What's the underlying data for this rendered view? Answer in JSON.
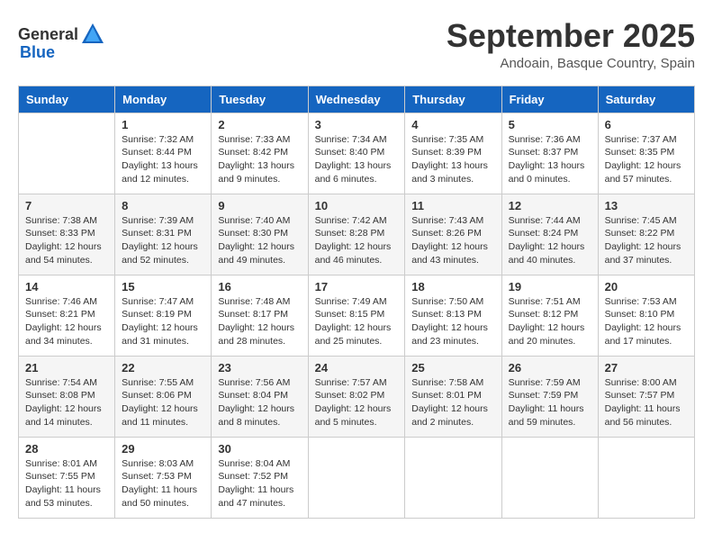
{
  "logo": {
    "general": "General",
    "blue": "Blue"
  },
  "title": "September 2025",
  "subtitle": "Andoain, Basque Country, Spain",
  "headers": [
    "Sunday",
    "Monday",
    "Tuesday",
    "Wednesday",
    "Thursday",
    "Friday",
    "Saturday"
  ],
  "weeks": [
    [
      {
        "day": "",
        "info": ""
      },
      {
        "day": "1",
        "info": "Sunrise: 7:32 AM\nSunset: 8:44 PM\nDaylight: 13 hours\nand 12 minutes."
      },
      {
        "day": "2",
        "info": "Sunrise: 7:33 AM\nSunset: 8:42 PM\nDaylight: 13 hours\nand 9 minutes."
      },
      {
        "day": "3",
        "info": "Sunrise: 7:34 AM\nSunset: 8:40 PM\nDaylight: 13 hours\nand 6 minutes."
      },
      {
        "day": "4",
        "info": "Sunrise: 7:35 AM\nSunset: 8:39 PM\nDaylight: 13 hours\nand 3 minutes."
      },
      {
        "day": "5",
        "info": "Sunrise: 7:36 AM\nSunset: 8:37 PM\nDaylight: 13 hours\nand 0 minutes."
      },
      {
        "day": "6",
        "info": "Sunrise: 7:37 AM\nSunset: 8:35 PM\nDaylight: 12 hours\nand 57 minutes."
      }
    ],
    [
      {
        "day": "7",
        "info": "Sunrise: 7:38 AM\nSunset: 8:33 PM\nDaylight: 12 hours\nand 54 minutes."
      },
      {
        "day": "8",
        "info": "Sunrise: 7:39 AM\nSunset: 8:31 PM\nDaylight: 12 hours\nand 52 minutes."
      },
      {
        "day": "9",
        "info": "Sunrise: 7:40 AM\nSunset: 8:30 PM\nDaylight: 12 hours\nand 49 minutes."
      },
      {
        "day": "10",
        "info": "Sunrise: 7:42 AM\nSunset: 8:28 PM\nDaylight: 12 hours\nand 46 minutes."
      },
      {
        "day": "11",
        "info": "Sunrise: 7:43 AM\nSunset: 8:26 PM\nDaylight: 12 hours\nand 43 minutes."
      },
      {
        "day": "12",
        "info": "Sunrise: 7:44 AM\nSunset: 8:24 PM\nDaylight: 12 hours\nand 40 minutes."
      },
      {
        "day": "13",
        "info": "Sunrise: 7:45 AM\nSunset: 8:22 PM\nDaylight: 12 hours\nand 37 minutes."
      }
    ],
    [
      {
        "day": "14",
        "info": "Sunrise: 7:46 AM\nSunset: 8:21 PM\nDaylight: 12 hours\nand 34 minutes."
      },
      {
        "day": "15",
        "info": "Sunrise: 7:47 AM\nSunset: 8:19 PM\nDaylight: 12 hours\nand 31 minutes."
      },
      {
        "day": "16",
        "info": "Sunrise: 7:48 AM\nSunset: 8:17 PM\nDaylight: 12 hours\nand 28 minutes."
      },
      {
        "day": "17",
        "info": "Sunrise: 7:49 AM\nSunset: 8:15 PM\nDaylight: 12 hours\nand 25 minutes."
      },
      {
        "day": "18",
        "info": "Sunrise: 7:50 AM\nSunset: 8:13 PM\nDaylight: 12 hours\nand 23 minutes."
      },
      {
        "day": "19",
        "info": "Sunrise: 7:51 AM\nSunset: 8:12 PM\nDaylight: 12 hours\nand 20 minutes."
      },
      {
        "day": "20",
        "info": "Sunrise: 7:53 AM\nSunset: 8:10 PM\nDaylight: 12 hours\nand 17 minutes."
      }
    ],
    [
      {
        "day": "21",
        "info": "Sunrise: 7:54 AM\nSunset: 8:08 PM\nDaylight: 12 hours\nand 14 minutes."
      },
      {
        "day": "22",
        "info": "Sunrise: 7:55 AM\nSunset: 8:06 PM\nDaylight: 12 hours\nand 11 minutes."
      },
      {
        "day": "23",
        "info": "Sunrise: 7:56 AM\nSunset: 8:04 PM\nDaylight: 12 hours\nand 8 minutes."
      },
      {
        "day": "24",
        "info": "Sunrise: 7:57 AM\nSunset: 8:02 PM\nDaylight: 12 hours\nand 5 minutes."
      },
      {
        "day": "25",
        "info": "Sunrise: 7:58 AM\nSunset: 8:01 PM\nDaylight: 12 hours\nand 2 minutes."
      },
      {
        "day": "26",
        "info": "Sunrise: 7:59 AM\nSunset: 7:59 PM\nDaylight: 11 hours\nand 59 minutes."
      },
      {
        "day": "27",
        "info": "Sunrise: 8:00 AM\nSunset: 7:57 PM\nDaylight: 11 hours\nand 56 minutes."
      }
    ],
    [
      {
        "day": "28",
        "info": "Sunrise: 8:01 AM\nSunset: 7:55 PM\nDaylight: 11 hours\nand 53 minutes."
      },
      {
        "day": "29",
        "info": "Sunrise: 8:03 AM\nSunset: 7:53 PM\nDaylight: 11 hours\nand 50 minutes."
      },
      {
        "day": "30",
        "info": "Sunrise: 8:04 AM\nSunset: 7:52 PM\nDaylight: 11 hours\nand 47 minutes."
      },
      {
        "day": "",
        "info": ""
      },
      {
        "day": "",
        "info": ""
      },
      {
        "day": "",
        "info": ""
      },
      {
        "day": "",
        "info": ""
      }
    ]
  ]
}
